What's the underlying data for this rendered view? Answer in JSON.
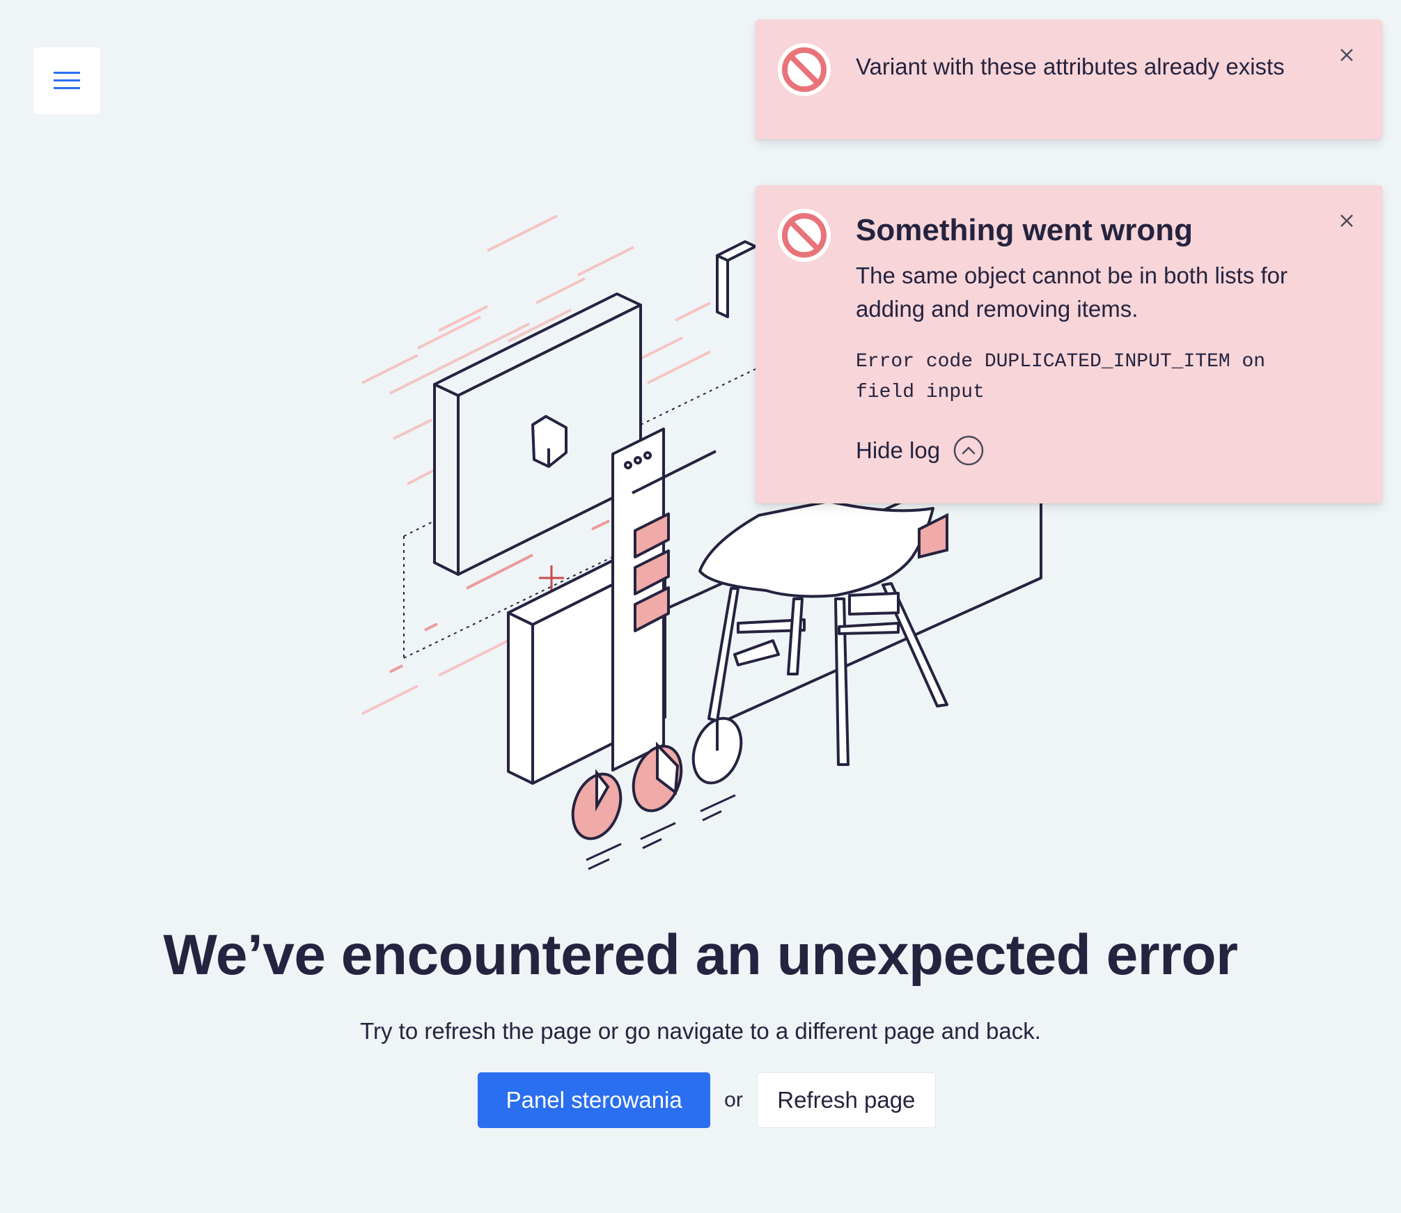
{
  "header": {
    "menu_icon": "hamburger-icon"
  },
  "error_page": {
    "title": "We’ve encountered an unexpected error",
    "subtitle": "Try to refresh the page or go navigate to a different page and back.",
    "primary_button": "Panel sterowania",
    "separator": "or",
    "secondary_button": "Refresh page"
  },
  "notifications": [
    {
      "icon": "block-icon",
      "message": "Variant with these attributes already exists",
      "close_icon": "close-icon"
    },
    {
      "icon": "block-icon",
      "title": "Something went wrong",
      "message": "The same object cannot be in both lists for adding and removing items.",
      "code_text": "Error code DUPLICATED_INPUT_ITEM on field input",
      "toggle_label": "Hide log",
      "toggle_icon": "chevron-up-circle-icon",
      "close_icon": "close-icon"
    }
  ],
  "colors": {
    "background": "#eff4f7",
    "primary": "#2a6ff0",
    "toast_bg": "#f7d5d8",
    "error_icon": "#e8747a",
    "text": "#25233f",
    "illustration_accent": "#f0aaa8"
  }
}
